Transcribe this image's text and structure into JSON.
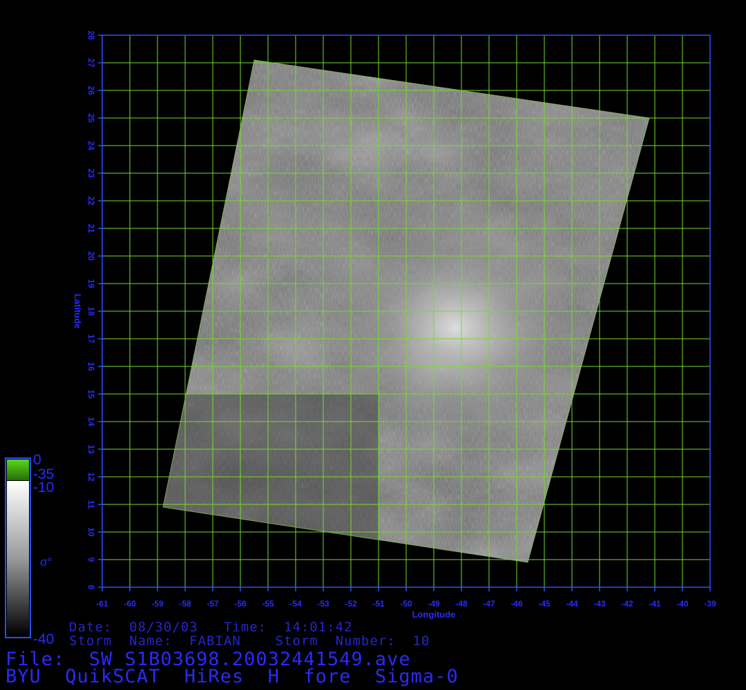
{
  "chart_data": {
    "type": "heatmap",
    "xlabel": "Longitude",
    "ylabel": "Latitude",
    "xlim": [
      -61,
      -39
    ],
    "ylim": [
      8,
      28
    ],
    "x_ticks": [
      -61,
      -60,
      -59,
      -58,
      -57,
      -56,
      -55,
      -54,
      -53,
      -52,
      -51,
      -50,
      -49,
      -48,
      -47,
      -46,
      -45,
      -44,
      -43,
      -42,
      -41,
      -40,
      -39
    ],
    "y_ticks": [
      8,
      9,
      10,
      11,
      12,
      13,
      14,
      15,
      16,
      17,
      18,
      19,
      20,
      21,
      22,
      23,
      24,
      25,
      26,
      27,
      28
    ],
    "grid": true,
    "swath_corners": [
      {
        "lon": -55.5,
        "lat": 27.1
      },
      {
        "lon": -41.2,
        "lat": 25.0
      },
      {
        "lon": -45.6,
        "lat": 8.9
      },
      {
        "lon": -58.8,
        "lat": 10.9
      }
    ],
    "bright_center": {
      "lon": -48.2,
      "lat": 17.4
    },
    "colorbar": {
      "label": "σ°",
      "ticks": [
        "0",
        "-35",
        "-10",
        "-40"
      ],
      "green_segment": [
        -35,
        0
      ],
      "grayscale_segment": [
        -40,
        -10
      ]
    },
    "colors": {
      "grid": "#78dc28",
      "frame": "#2a50ff",
      "tick_label": "#2a2aff",
      "colorbar_green": "#3aa010",
      "background": "#000000"
    }
  },
  "info": {
    "date_line": "Date:  08/30/03   Time:  14:01:42",
    "storm_line": "Storm  Name:  FABIAN    Storm  Number:  10",
    "file_line": "File:  SW_S1B03698.20032441549.ave",
    "product_line": "BYU  QuikSCAT  HiRes  H  fore  Sigma-0"
  }
}
